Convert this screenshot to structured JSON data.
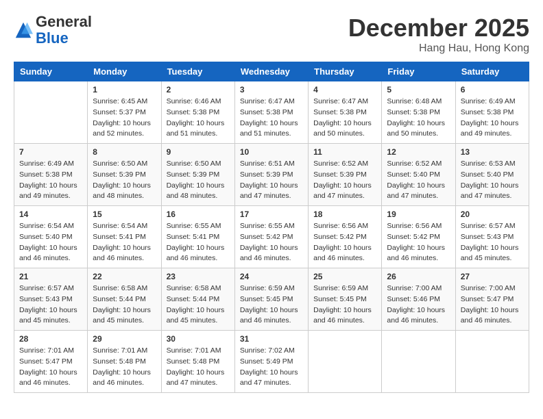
{
  "header": {
    "logo": {
      "general": "General",
      "blue": "Blue"
    },
    "month_title": "December 2025",
    "location": "Hang Hau, Hong Kong"
  },
  "weekdays": [
    "Sunday",
    "Monday",
    "Tuesday",
    "Wednesday",
    "Thursday",
    "Friday",
    "Saturday"
  ],
  "weeks": [
    [
      {
        "day": "",
        "info": ""
      },
      {
        "day": "1",
        "info": "Sunrise: 6:45 AM\nSunset: 5:37 PM\nDaylight: 10 hours\nand 52 minutes."
      },
      {
        "day": "2",
        "info": "Sunrise: 6:46 AM\nSunset: 5:38 PM\nDaylight: 10 hours\nand 51 minutes."
      },
      {
        "day": "3",
        "info": "Sunrise: 6:47 AM\nSunset: 5:38 PM\nDaylight: 10 hours\nand 51 minutes."
      },
      {
        "day": "4",
        "info": "Sunrise: 6:47 AM\nSunset: 5:38 PM\nDaylight: 10 hours\nand 50 minutes."
      },
      {
        "day": "5",
        "info": "Sunrise: 6:48 AM\nSunset: 5:38 PM\nDaylight: 10 hours\nand 50 minutes."
      },
      {
        "day": "6",
        "info": "Sunrise: 6:49 AM\nSunset: 5:38 PM\nDaylight: 10 hours\nand 49 minutes."
      }
    ],
    [
      {
        "day": "7",
        "info": "Sunrise: 6:49 AM\nSunset: 5:38 PM\nDaylight: 10 hours\nand 49 minutes."
      },
      {
        "day": "8",
        "info": "Sunrise: 6:50 AM\nSunset: 5:39 PM\nDaylight: 10 hours\nand 48 minutes."
      },
      {
        "day": "9",
        "info": "Sunrise: 6:50 AM\nSunset: 5:39 PM\nDaylight: 10 hours\nand 48 minutes."
      },
      {
        "day": "10",
        "info": "Sunrise: 6:51 AM\nSunset: 5:39 PM\nDaylight: 10 hours\nand 47 minutes."
      },
      {
        "day": "11",
        "info": "Sunrise: 6:52 AM\nSunset: 5:39 PM\nDaylight: 10 hours\nand 47 minutes."
      },
      {
        "day": "12",
        "info": "Sunrise: 6:52 AM\nSunset: 5:40 PM\nDaylight: 10 hours\nand 47 minutes."
      },
      {
        "day": "13",
        "info": "Sunrise: 6:53 AM\nSunset: 5:40 PM\nDaylight: 10 hours\nand 47 minutes."
      }
    ],
    [
      {
        "day": "14",
        "info": "Sunrise: 6:54 AM\nSunset: 5:40 PM\nDaylight: 10 hours\nand 46 minutes."
      },
      {
        "day": "15",
        "info": "Sunrise: 6:54 AM\nSunset: 5:41 PM\nDaylight: 10 hours\nand 46 minutes."
      },
      {
        "day": "16",
        "info": "Sunrise: 6:55 AM\nSunset: 5:41 PM\nDaylight: 10 hours\nand 46 minutes."
      },
      {
        "day": "17",
        "info": "Sunrise: 6:55 AM\nSunset: 5:42 PM\nDaylight: 10 hours\nand 46 minutes."
      },
      {
        "day": "18",
        "info": "Sunrise: 6:56 AM\nSunset: 5:42 PM\nDaylight: 10 hours\nand 46 minutes."
      },
      {
        "day": "19",
        "info": "Sunrise: 6:56 AM\nSunset: 5:42 PM\nDaylight: 10 hours\nand 46 minutes."
      },
      {
        "day": "20",
        "info": "Sunrise: 6:57 AM\nSunset: 5:43 PM\nDaylight: 10 hours\nand 45 minutes."
      }
    ],
    [
      {
        "day": "21",
        "info": "Sunrise: 6:57 AM\nSunset: 5:43 PM\nDaylight: 10 hours\nand 45 minutes."
      },
      {
        "day": "22",
        "info": "Sunrise: 6:58 AM\nSunset: 5:44 PM\nDaylight: 10 hours\nand 45 minutes."
      },
      {
        "day": "23",
        "info": "Sunrise: 6:58 AM\nSunset: 5:44 PM\nDaylight: 10 hours\nand 45 minutes."
      },
      {
        "day": "24",
        "info": "Sunrise: 6:59 AM\nSunset: 5:45 PM\nDaylight: 10 hours\nand 46 minutes."
      },
      {
        "day": "25",
        "info": "Sunrise: 6:59 AM\nSunset: 5:45 PM\nDaylight: 10 hours\nand 46 minutes."
      },
      {
        "day": "26",
        "info": "Sunrise: 7:00 AM\nSunset: 5:46 PM\nDaylight: 10 hours\nand 46 minutes."
      },
      {
        "day": "27",
        "info": "Sunrise: 7:00 AM\nSunset: 5:47 PM\nDaylight: 10 hours\nand 46 minutes."
      }
    ],
    [
      {
        "day": "28",
        "info": "Sunrise: 7:01 AM\nSunset: 5:47 PM\nDaylight: 10 hours\nand 46 minutes."
      },
      {
        "day": "29",
        "info": "Sunrise: 7:01 AM\nSunset: 5:48 PM\nDaylight: 10 hours\nand 46 minutes."
      },
      {
        "day": "30",
        "info": "Sunrise: 7:01 AM\nSunset: 5:48 PM\nDaylight: 10 hours\nand 47 minutes."
      },
      {
        "day": "31",
        "info": "Sunrise: 7:02 AM\nSunset: 5:49 PM\nDaylight: 10 hours\nand 47 minutes."
      },
      {
        "day": "",
        "info": ""
      },
      {
        "day": "",
        "info": ""
      },
      {
        "day": "",
        "info": ""
      }
    ]
  ]
}
